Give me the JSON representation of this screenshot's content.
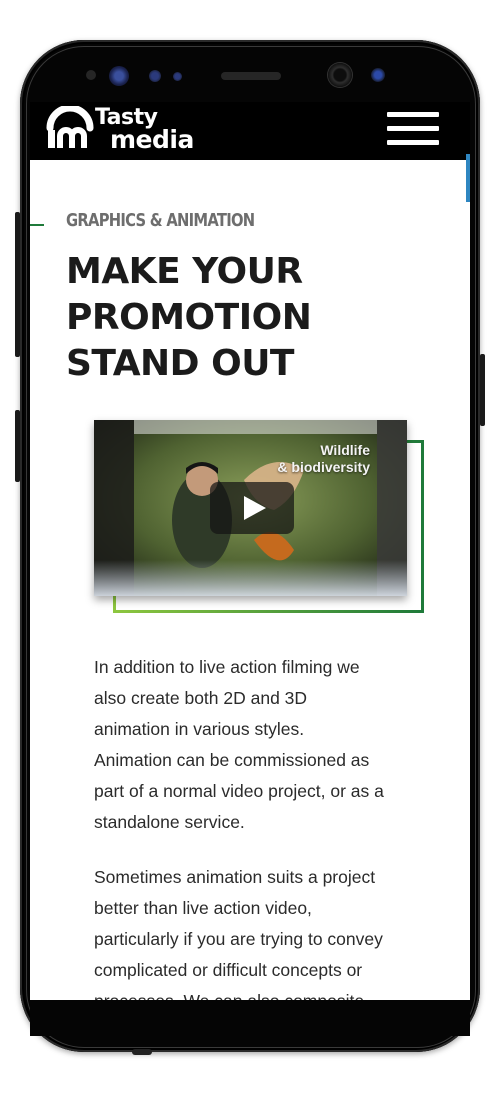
{
  "header": {
    "logo_line1": "Tasty",
    "logo_line2": "media",
    "menu_label": "Menu"
  },
  "section": {
    "eyebrow": "GRAPHICS & ANIMATION",
    "headline_lines": [
      "MAKE YOUR",
      "PROMOTION",
      "STAND OUT"
    ]
  },
  "video": {
    "caption_line1": "Wildlife",
    "caption_line2": "& biodiversity"
  },
  "content": {
    "paragraph1_lines": [
      "In addition to live action filming we",
      "also create both 2D and 3D",
      "animation in various styles.",
      "Animation can be commissioned as",
      "part of a normal video project, or as a",
      "standalone service."
    ],
    "paragraph2_lines": [
      "Sometimes animation suits a project",
      "better than live action video,",
      "particularly if you are trying to convey",
      "complicated or difficult concepts or",
      "processes. We can also composite"
    ]
  },
  "colors": {
    "brand_green": "#1f7a3a",
    "accent_lime": "#8dc63f",
    "header_bg": "#000000",
    "eyebrow_grey": "#6e6e6e",
    "scroll_accent": "#2e86c1"
  }
}
